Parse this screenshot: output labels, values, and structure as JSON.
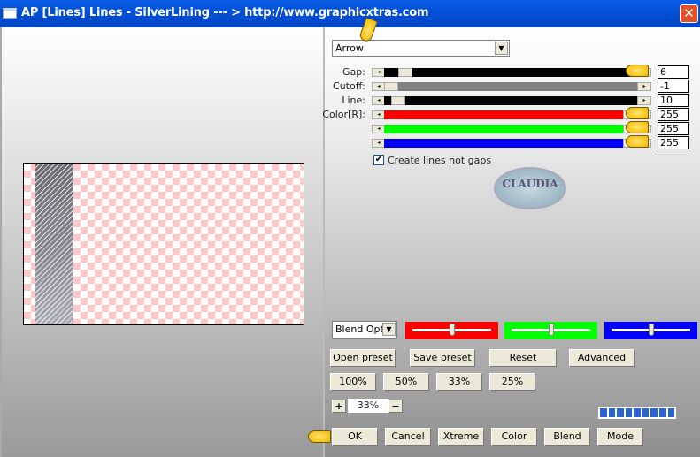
{
  "window": {
    "title": "AP [Lines]  Lines - SilverLining     --- > http://www.graphicxtras.com",
    "close_glyph": "✕"
  },
  "preset_dropdown": {
    "value": "Arrow",
    "arrow_glyph": "▼"
  },
  "sliders": [
    {
      "label": "Gap:",
      "value": "6",
      "position": 0.06,
      "track_color": "#000000"
    },
    {
      "label": "Cutoff:",
      "value": "-1",
      "position": 0.0,
      "track_color": "#808080"
    },
    {
      "label": "Line:",
      "value": "10",
      "position": 0.03,
      "track_color": "#000000"
    },
    {
      "label": "Color[R]:",
      "value": "255",
      "position": 1.0,
      "track_color": "#ff0000"
    },
    {
      "label": "",
      "value": "255",
      "position": 1.0,
      "track_color": "#00ff00"
    },
    {
      "label": "",
      "value": "255",
      "position": 1.0,
      "track_color": "#0000ff"
    }
  ],
  "checkbox": {
    "label": "Create lines not gaps",
    "checked": true,
    "glyph": "✔"
  },
  "logo": {
    "text": "CLAUDIA"
  },
  "blend_dropdown": {
    "value": "Blend Optio",
    "arrow_glyph": "▼"
  },
  "blend_sliders": [
    {
      "color": "#ff0000",
      "position": 0.5
    },
    {
      "color": "#00ff00",
      "position": 0.5
    },
    {
      "color": "#0000ff",
      "position": 0.5
    }
  ],
  "buttons": {
    "open_preset": "Open preset",
    "save_preset": "Save preset",
    "reset": "Reset",
    "advanced": "Advanced",
    "zoom_100": "100%",
    "zoom_50": "50%",
    "zoom_33": "33%",
    "zoom_25": "25%",
    "ok": "OK",
    "cancel": "Cancel",
    "xtreme": "Xtreme",
    "color": "Color",
    "blend": "Blend",
    "mode": "Mode"
  },
  "zoom_control": {
    "plus": "+",
    "value": "33%",
    "minus": "−"
  },
  "progress": {
    "segments": 9,
    "fraction": 1.0
  },
  "scroll_arrows": {
    "left": "◂",
    "right": "▸"
  }
}
